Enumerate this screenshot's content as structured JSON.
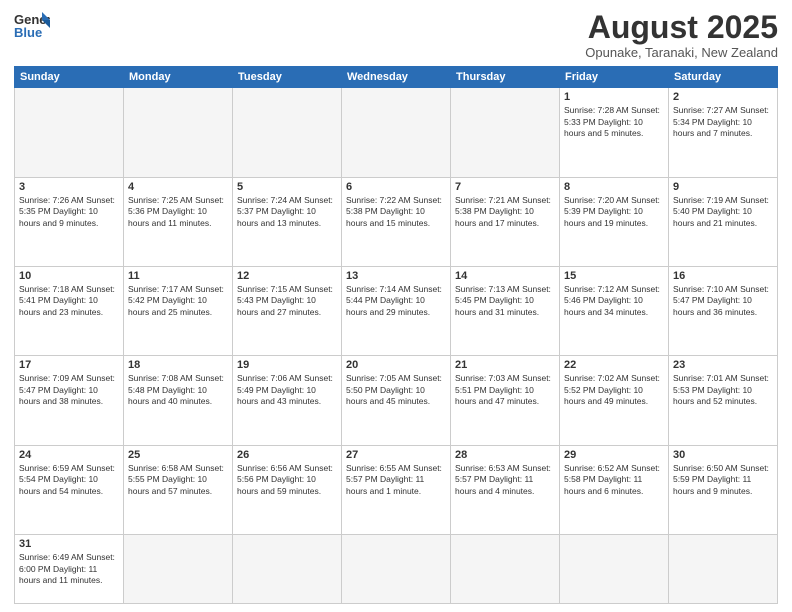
{
  "header": {
    "logo_general": "General",
    "logo_blue": "Blue",
    "title": "August 2025",
    "subtitle": "Opunake, Taranaki, New Zealand"
  },
  "days_of_week": [
    "Sunday",
    "Monday",
    "Tuesday",
    "Wednesday",
    "Thursday",
    "Friday",
    "Saturday"
  ],
  "weeks": [
    [
      {
        "day": "",
        "info": "",
        "empty": true
      },
      {
        "day": "",
        "info": "",
        "empty": true
      },
      {
        "day": "",
        "info": "",
        "empty": true
      },
      {
        "day": "",
        "info": "",
        "empty": true
      },
      {
        "day": "",
        "info": "",
        "empty": true
      },
      {
        "day": "1",
        "info": "Sunrise: 7:28 AM\nSunset: 5:33 PM\nDaylight: 10 hours\nand 5 minutes."
      },
      {
        "day": "2",
        "info": "Sunrise: 7:27 AM\nSunset: 5:34 PM\nDaylight: 10 hours\nand 7 minutes."
      }
    ],
    [
      {
        "day": "3",
        "info": "Sunrise: 7:26 AM\nSunset: 5:35 PM\nDaylight: 10 hours\nand 9 minutes."
      },
      {
        "day": "4",
        "info": "Sunrise: 7:25 AM\nSunset: 5:36 PM\nDaylight: 10 hours\nand 11 minutes."
      },
      {
        "day": "5",
        "info": "Sunrise: 7:24 AM\nSunset: 5:37 PM\nDaylight: 10 hours\nand 13 minutes."
      },
      {
        "day": "6",
        "info": "Sunrise: 7:22 AM\nSunset: 5:38 PM\nDaylight: 10 hours\nand 15 minutes."
      },
      {
        "day": "7",
        "info": "Sunrise: 7:21 AM\nSunset: 5:38 PM\nDaylight: 10 hours\nand 17 minutes."
      },
      {
        "day": "8",
        "info": "Sunrise: 7:20 AM\nSunset: 5:39 PM\nDaylight: 10 hours\nand 19 minutes."
      },
      {
        "day": "9",
        "info": "Sunrise: 7:19 AM\nSunset: 5:40 PM\nDaylight: 10 hours\nand 21 minutes."
      }
    ],
    [
      {
        "day": "10",
        "info": "Sunrise: 7:18 AM\nSunset: 5:41 PM\nDaylight: 10 hours\nand 23 minutes."
      },
      {
        "day": "11",
        "info": "Sunrise: 7:17 AM\nSunset: 5:42 PM\nDaylight: 10 hours\nand 25 minutes."
      },
      {
        "day": "12",
        "info": "Sunrise: 7:15 AM\nSunset: 5:43 PM\nDaylight: 10 hours\nand 27 minutes."
      },
      {
        "day": "13",
        "info": "Sunrise: 7:14 AM\nSunset: 5:44 PM\nDaylight: 10 hours\nand 29 minutes."
      },
      {
        "day": "14",
        "info": "Sunrise: 7:13 AM\nSunset: 5:45 PM\nDaylight: 10 hours\nand 31 minutes."
      },
      {
        "day": "15",
        "info": "Sunrise: 7:12 AM\nSunset: 5:46 PM\nDaylight: 10 hours\nand 34 minutes."
      },
      {
        "day": "16",
        "info": "Sunrise: 7:10 AM\nSunset: 5:47 PM\nDaylight: 10 hours\nand 36 minutes."
      }
    ],
    [
      {
        "day": "17",
        "info": "Sunrise: 7:09 AM\nSunset: 5:47 PM\nDaylight: 10 hours\nand 38 minutes."
      },
      {
        "day": "18",
        "info": "Sunrise: 7:08 AM\nSunset: 5:48 PM\nDaylight: 10 hours\nand 40 minutes."
      },
      {
        "day": "19",
        "info": "Sunrise: 7:06 AM\nSunset: 5:49 PM\nDaylight: 10 hours\nand 43 minutes."
      },
      {
        "day": "20",
        "info": "Sunrise: 7:05 AM\nSunset: 5:50 PM\nDaylight: 10 hours\nand 45 minutes."
      },
      {
        "day": "21",
        "info": "Sunrise: 7:03 AM\nSunset: 5:51 PM\nDaylight: 10 hours\nand 47 minutes."
      },
      {
        "day": "22",
        "info": "Sunrise: 7:02 AM\nSunset: 5:52 PM\nDaylight: 10 hours\nand 49 minutes."
      },
      {
        "day": "23",
        "info": "Sunrise: 7:01 AM\nSunset: 5:53 PM\nDaylight: 10 hours\nand 52 minutes."
      }
    ],
    [
      {
        "day": "24",
        "info": "Sunrise: 6:59 AM\nSunset: 5:54 PM\nDaylight: 10 hours\nand 54 minutes."
      },
      {
        "day": "25",
        "info": "Sunrise: 6:58 AM\nSunset: 5:55 PM\nDaylight: 10 hours\nand 57 minutes."
      },
      {
        "day": "26",
        "info": "Sunrise: 6:56 AM\nSunset: 5:56 PM\nDaylight: 10 hours\nand 59 minutes."
      },
      {
        "day": "27",
        "info": "Sunrise: 6:55 AM\nSunset: 5:57 PM\nDaylight: 11 hours\nand 1 minute."
      },
      {
        "day": "28",
        "info": "Sunrise: 6:53 AM\nSunset: 5:57 PM\nDaylight: 11 hours\nand 4 minutes."
      },
      {
        "day": "29",
        "info": "Sunrise: 6:52 AM\nSunset: 5:58 PM\nDaylight: 11 hours\nand 6 minutes."
      },
      {
        "day": "30",
        "info": "Sunrise: 6:50 AM\nSunset: 5:59 PM\nDaylight: 11 hours\nand 9 minutes."
      }
    ],
    [
      {
        "day": "31",
        "info": "Sunrise: 6:49 AM\nSunset: 6:00 PM\nDaylight: 11 hours\nand 11 minutes."
      },
      {
        "day": "",
        "info": "",
        "empty": true
      },
      {
        "day": "",
        "info": "",
        "empty": true
      },
      {
        "day": "",
        "info": "",
        "empty": true
      },
      {
        "day": "",
        "info": "",
        "empty": true
      },
      {
        "day": "",
        "info": "",
        "empty": true
      },
      {
        "day": "",
        "info": "",
        "empty": true
      }
    ]
  ]
}
